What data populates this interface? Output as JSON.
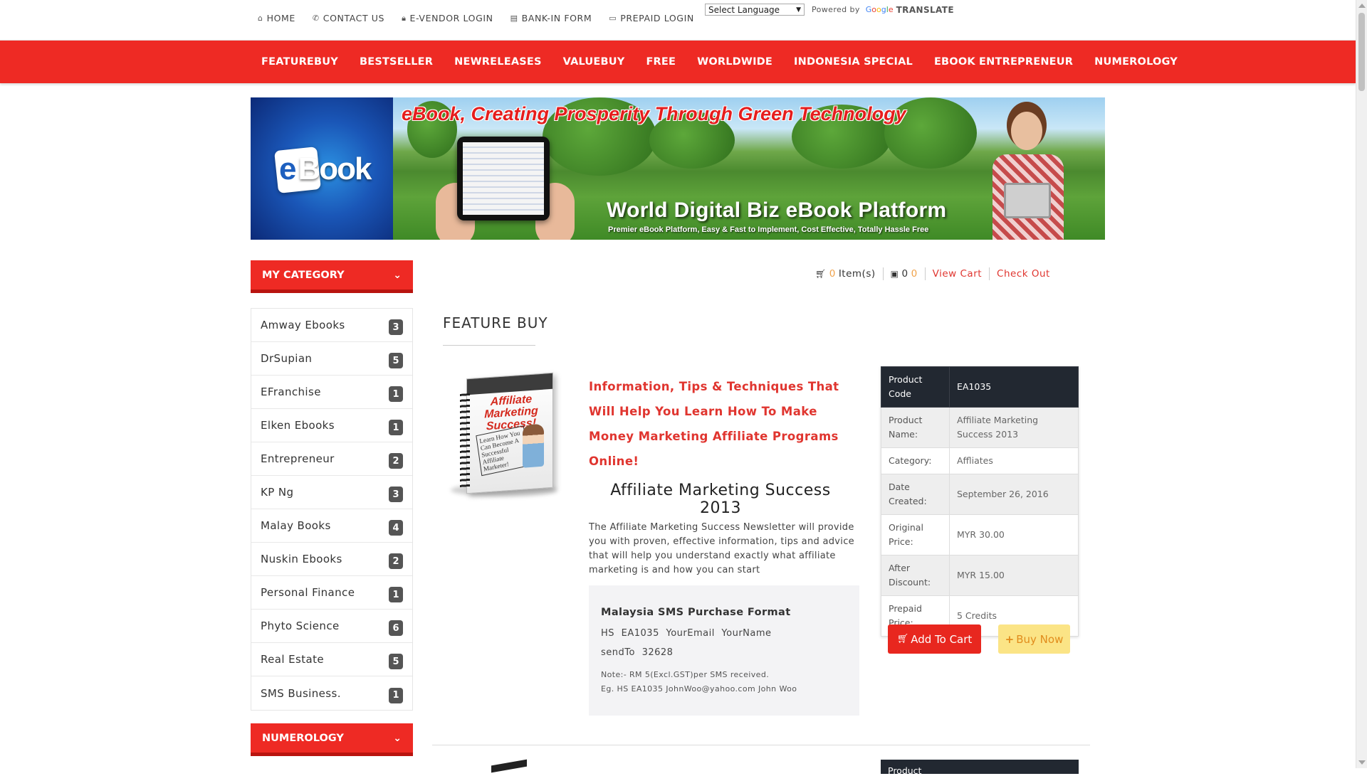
{
  "topbar": {
    "links": [
      {
        "icon": "home-icon",
        "glyph": "⌂",
        "label": "HOME"
      },
      {
        "icon": "phone-icon",
        "glyph": "✆",
        "label": "CONTACT US"
      },
      {
        "icon": "lock-icon",
        "glyph": "🔒︎",
        "label": "E-VENDOR LOGIN"
      },
      {
        "icon": "file-icon",
        "glyph": "▤",
        "label": "BANK-IN FORM"
      },
      {
        "icon": "credit-card-icon",
        "glyph": "▭",
        "label": "PREPAID LOGIN"
      }
    ],
    "language_select": "Select Language",
    "powered_by": "Powered by",
    "google": "Google",
    "translate": "TRANSLATE"
  },
  "nav": {
    "items": [
      "FEATUREBUY",
      "BESTSELLER",
      "NEWRELEASES",
      "VALUEBUY",
      "FREE",
      "WORLDWIDE",
      "INDONESIA SPECIAL",
      "EBOOK ENTREPRENEUR",
      "NUMEROLOGY"
    ]
  },
  "banner": {
    "logo_text": "Book",
    "logo_letter": "e",
    "tagline": "eBook, Creating Prosperity Through Green Technology",
    "title": "World Digital Biz eBook Platform",
    "subtitle": "Premier eBook Platform, Easy & Fast to Implement, Cost Effective, Totally Hassle Free"
  },
  "sidebar": {
    "category_heading": "MY CATEGORY",
    "categories": [
      {
        "name": "Amway Ebooks",
        "count": "3"
      },
      {
        "name": "DrSupian",
        "count": "5"
      },
      {
        "name": "EFranchise",
        "count": "1"
      },
      {
        "name": "Elken Ebooks",
        "count": "1"
      },
      {
        "name": "Entrepreneur",
        "count": "2"
      },
      {
        "name": "KP Ng",
        "count": "3"
      },
      {
        "name": "Malay Books",
        "count": "4"
      },
      {
        "name": "Nuskin Ebooks",
        "count": "2"
      },
      {
        "name": "Personal Finance",
        "count": "1"
      },
      {
        "name": "Phyto Science",
        "count": "6"
      },
      {
        "name": "Real Estate",
        "count": "5"
      },
      {
        "name": "SMS Business.",
        "count": "1"
      }
    ],
    "numerology_heading": "NUMEROLOGY"
  },
  "cart": {
    "items_count": "0",
    "items_label": "Item(s)",
    "credits_count": "0",
    "credits_value": "0",
    "view_cart": "View Cart",
    "check_out": "Check Out"
  },
  "feature": {
    "section_title": "FEATURE BUY",
    "book_cover_title": "Affiliate Marketing Success!",
    "book_cover_text": "Learn How You Can Become A Successful Affiliate Marketer!",
    "promo": "Information, Tips & Techniques That Will Help You Learn How To Make Money Marketing Affiliate Programs Online!",
    "product_heading": "Affiliate Marketing Success 2013",
    "description": "The Affiliate Marketing Success Newsletter will provide you with proven, effective information, tips and advice that will help you understand exactly what affiliate marketing is and how you can start",
    "sms": {
      "title": "Malaysia SMS Purchase Format",
      "format": "HS EA1035 YourEmail YourName",
      "send_to": "sendTo 32628",
      "note": "Note:- RM 5(Excl.GST)per SMS received.",
      "example": "Eg. HS EA1035 JohnWoo@yahoo.com John Woo"
    },
    "details": [
      {
        "key": "Product Code",
        "value": "EA1035"
      },
      {
        "key": "Product Name:",
        "value": "Affiliate Marketing Success 2013"
      },
      {
        "key": "Category:",
        "value": "Affliates"
      },
      {
        "key": "Date Created:",
        "value": "September 26, 2016"
      },
      {
        "key": "Original Price:",
        "value": "MYR 30.00"
      },
      {
        "key": "After Discount:",
        "value": "MYR 15.00"
      },
      {
        "key": "Prepaid Price:",
        "value": "5 Credits"
      }
    ],
    "add_to_cart": "Add To Cart",
    "buy_now": "Buy Now"
  },
  "next_product": {
    "details_first_key": "Product"
  },
  "colors": {
    "brand_red": "#ee2a24",
    "dark_header": "#222831",
    "buy_now_bg": "#fbe486"
  }
}
